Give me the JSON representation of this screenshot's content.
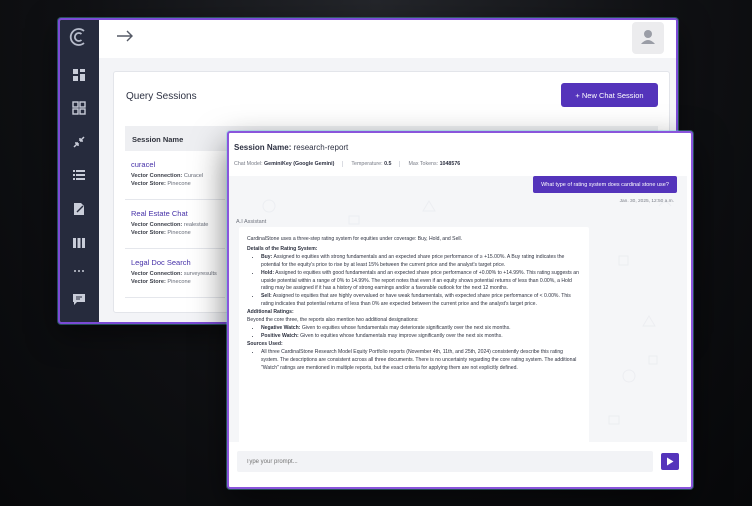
{
  "colors": {
    "accent": "#5434bb",
    "sidebar": "#262b3d",
    "frame_border": "#7b4bd6"
  },
  "sidebar": {
    "logo": "app-logo-icon",
    "items": [
      {
        "icon": "dashboard-icon"
      },
      {
        "icon": "grid-icon"
      },
      {
        "icon": "compress-arrows-icon"
      },
      {
        "icon": "list-icon"
      },
      {
        "icon": "edit-document-icon"
      },
      {
        "icon": "columns-icon"
      },
      {
        "icon": "more-horizontal-icon"
      },
      {
        "icon": "chat-bubble-icon"
      }
    ]
  },
  "topbar": {
    "nav_icon": "arrow-right-icon",
    "avatar_icon": "user-avatar-icon"
  },
  "query_sessions": {
    "title": "Query Sessions",
    "new_button": "+  New Chat Session",
    "column_header": "Session Name",
    "rows": [
      {
        "name": "curacel",
        "connection_label": "Vector Connection:",
        "connection": "Curacel",
        "store_label": "Vector Store:",
        "store": "Pinecone"
      },
      {
        "name": "Real Estate Chat",
        "connection_label": "Vector Connection:",
        "connection": "realestate",
        "store_label": "Vector Store:",
        "store": "Pinecone"
      },
      {
        "name": "Legal Doc Search",
        "connection_label": "Vector Connection:",
        "connection": "surveyresults",
        "store_label": "Vector Store:",
        "store": "Pinecone"
      }
    ]
  },
  "chat": {
    "session_label": "Session Name:",
    "session_name": "research-report",
    "model_label": "Chat Model:",
    "model": "GeminiKey (Google Gemini)",
    "temperature_label": "Temperature:",
    "temperature": "0.5",
    "max_tokens_label": "Max Tokens:",
    "max_tokens": "1048576",
    "user_message": "What type of rating system does cardinal stone use?",
    "user_time": "Jan. 30, 2025, 12:50 a.m.",
    "assistant_label": "A.I Assistant",
    "reply": {
      "intro": "CardinalStone uses a three-step rating system for equities under coverage: Buy, Hold, and Sell.",
      "details_heading": "Details of the Rating System:",
      "details": [
        {
          "term": "Buy:",
          "text": "Assigned to equities with strong fundamentals and an expected share price performance of ≥ +15.00%. A Buy rating indicates the potential for the equity's price to rise by at least 15% between the current price and the analyst's target price."
        },
        {
          "term": "Hold:",
          "text": "Assigned to equities with good fundamentals and an expected share price performance of +0.00% to +14.99%. This rating suggests an upside potential within a range of 0% to 14.99%. The report notes that even if an equity shows potential returns of less than 0.00%, a Hold rating may be assigned if it has a history of strong earnings and/or a favorable outlook for the next 12 months."
        },
        {
          "term": "Sell:",
          "text": "Assigned to equities that are highly overvalued or have weak fundamentals, with expected share price performance of < 0.00%. This rating indicates that potential returns of less than 0% are expected between the current price and the analyst's target price."
        }
      ],
      "additional_heading": "Additional Ratings:",
      "additional_intro": "Beyond the core three, the reports also mention two additional designations:",
      "additional": [
        {
          "term": "Negative Watch:",
          "text": "Given to equities whose fundamentals may deteriorate significantly over the next six months."
        },
        {
          "term": "Positive Watch:",
          "text": "Given to equities whose fundamentals may improve significantly over the next six months."
        }
      ],
      "sources_heading": "Sources Used:",
      "sources": [
        {
          "text": "All three CardinalStone Research Model Equity Portfolio reports (November 4th, 11th, and 25th, 2024) consistently describe this rating system. The descriptions are consistent across all three documents. There is no uncertainty regarding the core rating system. The additional \"Watch\" ratings are mentioned in multiple reports, but the exact criteria for applying them are not explicitly defined."
        }
      ]
    },
    "input_placeholder": "Type your prompt...",
    "send_icon": "send-play-icon"
  }
}
